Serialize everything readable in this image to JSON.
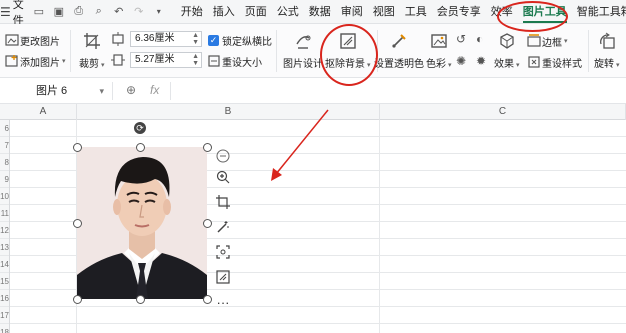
{
  "menubar": {
    "file_label": "文件",
    "tabs": [
      {
        "label": "开始"
      },
      {
        "label": "插入"
      },
      {
        "label": "页面"
      },
      {
        "label": "公式"
      },
      {
        "label": "数据"
      },
      {
        "label": "审阅"
      },
      {
        "label": "视图"
      },
      {
        "label": "工具"
      },
      {
        "label": "会员专享"
      },
      {
        "label": "效率"
      },
      {
        "label": "图片工具"
      },
      {
        "label": "智能工具箱"
      }
    ],
    "active_tab": "图片工具"
  },
  "ribbon": {
    "change_picture": "更改图片",
    "add_picture": "添加图片",
    "crop": "裁剪",
    "height_value": "6.36厘米",
    "width_value": "5.27厘米",
    "lock_ratio": "锁定纵横比",
    "reset_size": "重设大小",
    "picture_design": "图片设计",
    "remove_background": "抠除背景",
    "set_transparent": "设置透明色",
    "color": "色彩",
    "effects": "效果",
    "border": "边框",
    "reset_style": "重设样式",
    "rotate": "旋转"
  },
  "formula_bar": {
    "name_box": "图片 6",
    "fx_label": "fx"
  },
  "columns": [
    "A",
    "B",
    "C"
  ],
  "rows": [
    "6",
    "7",
    "8",
    "9",
    "10",
    "11",
    "12",
    "13",
    "14",
    "15",
    "16",
    "17",
    "18"
  ],
  "colors": {
    "accent_green": "#1c7a4f",
    "annotation_red": "#d9251d",
    "check_blue": "#2a7ae2"
  }
}
